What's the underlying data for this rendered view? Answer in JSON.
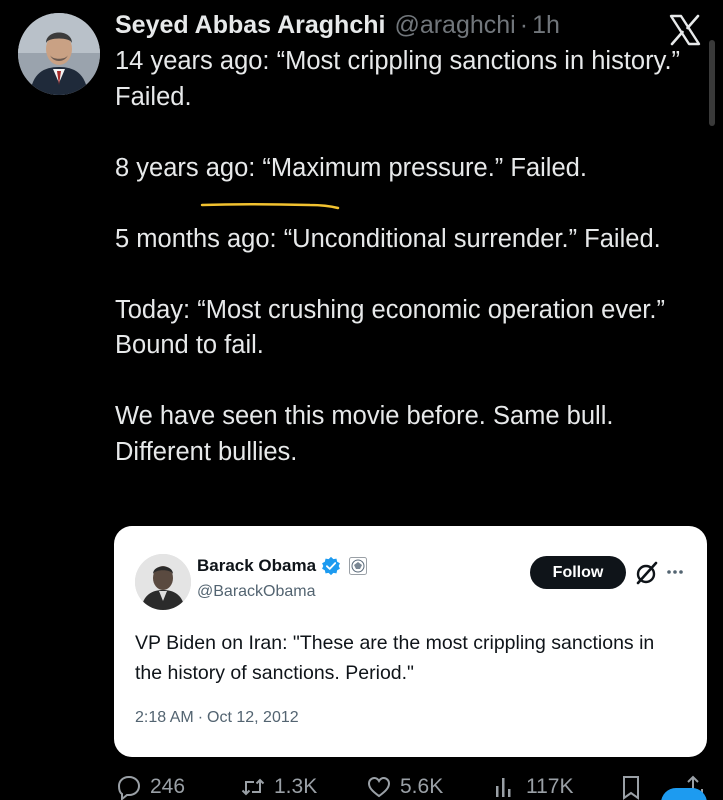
{
  "tweet": {
    "author_name": "Seyed Abbas Araghchi",
    "author_handle": "@araghchi",
    "separator": "·",
    "time": "1h",
    "paragraphs": [
      "14 years ago: “Most crippling sanctions in history.” Failed.",
      "8 years ago: “Maximum pressure.” Failed.",
      "5 months ago: “Unconditional surrender.” Failed.",
      "Today: “Most crushing economic operation ever.” Bound to fail.",
      "We have seen this movie before. Same bull. Different bullies."
    ]
  },
  "quote": {
    "author_name": "Barack Obama",
    "author_handle": "@BarackObama",
    "follow_label": "Follow",
    "text": "VP Biden on Iran: \"These are the most crippling sanctions in the history of sanctions. Period.\"",
    "time": "2:18 AM",
    "separator": "·",
    "date": "Oct 12, 2012"
  },
  "actions": {
    "replies": "246",
    "reposts": "1.3K",
    "likes": "5.6K",
    "views": "117K"
  },
  "colors": {
    "background": "#000000",
    "text": "#e7e9ea",
    "muted": "#71767b",
    "accent": "#1d9bf0",
    "highlight": "#f2c230"
  },
  "icons": {
    "brand": "x-logo-icon",
    "reply": "reply-icon",
    "repost": "repost-icon",
    "like": "heart-icon",
    "views": "views-icon",
    "bookmark": "bookmark-icon",
    "share": "share-icon"
  }
}
